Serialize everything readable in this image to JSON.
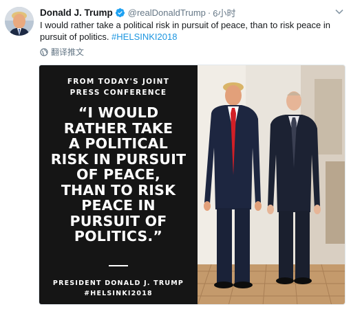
{
  "tweet": {
    "author_name": "Donald J. Trump",
    "handle": "@realDonaldTrump",
    "separator": "·",
    "time": "6小时",
    "text_main": "I would rather take a political risk in pursuit of peace, than to risk peace in pursuit of politics. ",
    "hashtag": "#HELSINKI2018",
    "translate_label": "翻译推文"
  },
  "image": {
    "header_line1": "FROM TODAY'S JOINT",
    "header_line2": "PRESS CONFERENCE",
    "quote_lines": [
      "“I WOULD",
      "RATHER TAKE",
      "A POLITICAL",
      "RISK IN PURSUIT",
      "OF PEACE,",
      "THAN TO RISK",
      "PEACE IN",
      "PURSUIT OF",
      "POLITICS.”"
    ],
    "footer_prefix": "PRESIDENT ",
    "footer_name": "DONALD J. TRUMP",
    "footer_hashtag": "#HELSINKI2018"
  },
  "icons": {
    "verified": "verified-badge-icon",
    "caret": "chevron-down-icon",
    "translate": "globe-icon"
  },
  "colors": {
    "link": "#1b95e0",
    "secondary_text": "#657786",
    "quote_bg": "#151515",
    "verified": "#1da1f2"
  }
}
